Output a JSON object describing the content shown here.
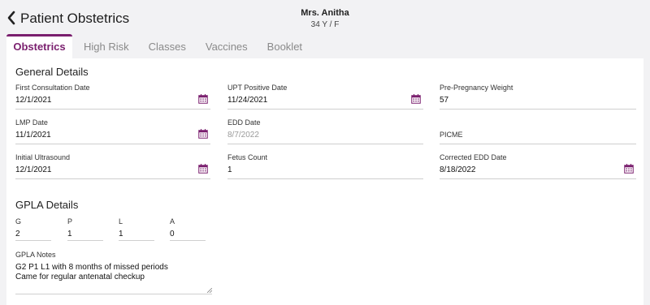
{
  "header": {
    "title": "Patient Obstetrics",
    "patient_name": "Mrs. Anitha",
    "patient_meta": "34 Y / F"
  },
  "tabs": [
    {
      "label": "Obstetrics",
      "active": true
    },
    {
      "label": "High Risk",
      "active": false
    },
    {
      "label": "Classes",
      "active": false
    },
    {
      "label": "Vaccines",
      "active": false
    },
    {
      "label": "Booklet",
      "active": false
    }
  ],
  "general": {
    "title": "General Details",
    "first_consultation": {
      "label": "First Consultation Date",
      "value": "12/1/2021"
    },
    "upt_positive": {
      "label": "UPT Positive Date",
      "value": "11/24/2021"
    },
    "pre_pregnancy_weight": {
      "label": "Pre-Pregnancy Weight",
      "value": "57"
    },
    "lmp": {
      "label": "LMP Date",
      "value": "11/1/2021"
    },
    "edd": {
      "label": "EDD Date",
      "value": "8/7/2022"
    },
    "picme": {
      "label": "PICME",
      "value": ""
    },
    "initial_ultrasound": {
      "label": "Initial Ultrasound",
      "value": "12/1/2021"
    },
    "fetus_count": {
      "label": "Fetus Count",
      "value": "1"
    },
    "corrected_edd": {
      "label": "Corrected EDD Date",
      "value": "8/18/2022"
    }
  },
  "gpla": {
    "title": "GPLA Details",
    "g": {
      "label": "G",
      "value": "2"
    },
    "p": {
      "label": "P",
      "value": "1"
    },
    "l": {
      "label": "L",
      "value": "1"
    },
    "a": {
      "label": "A",
      "value": "0"
    },
    "notes": {
      "label": "GPLA Notes",
      "line1": "G2 P1 L1  with 8 months of missed periods",
      "line2": "Came for regular antenatal checkup"
    }
  },
  "colors": {
    "accent": "#7a1f6e",
    "calendar_icon": "#7a1f6e",
    "background": "#f2f2f4"
  }
}
